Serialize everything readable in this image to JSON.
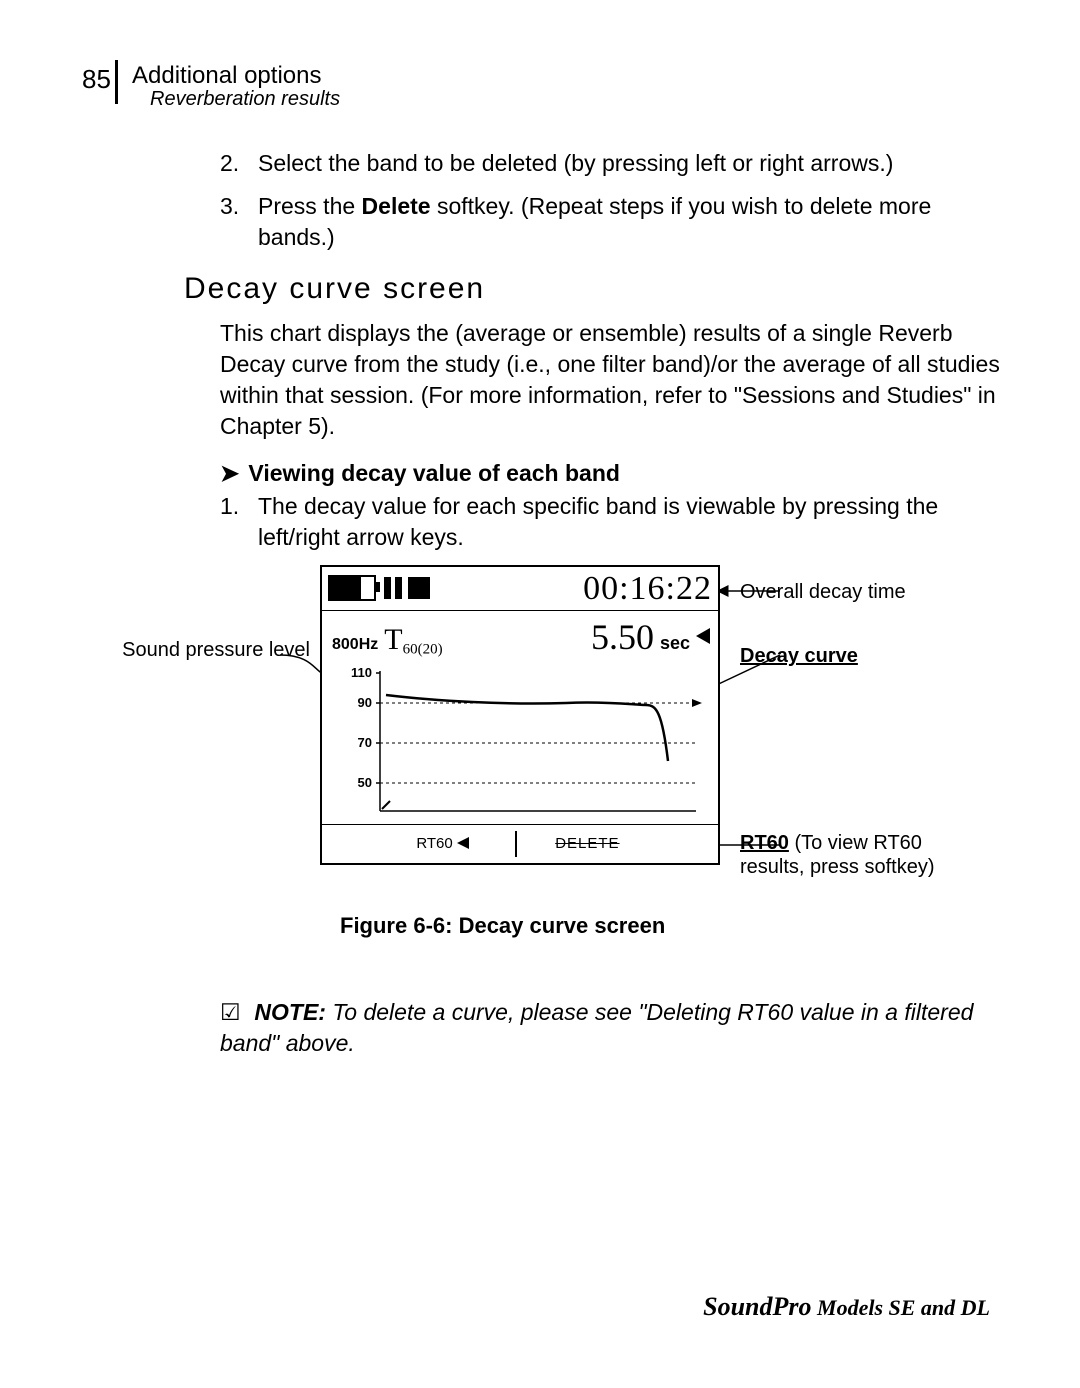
{
  "header": {
    "page_number": "85",
    "title": "Additional options",
    "subtitle": "Reverberation results"
  },
  "steps": {
    "s2_num": "2.",
    "s2_txt": "Select the band to be deleted (by pressing left or right arrows.)",
    "s3_num": "3.",
    "s3_txt_a": "Press the ",
    "s3_bold": "Delete",
    "s3_txt_b": " softkey.  (Repeat steps if you wish to delete more bands.)"
  },
  "section_heading": "Decay curve screen",
  "para1": "This chart displays the (average or ensemble) results of a single Reverb Decay curve from the study (i.e., one filter band)/or the average of all studies within that session.  (For more information, refer to \"Sessions and Studies\" in Chapter 5).",
  "proc": {
    "arrow": "➤",
    "heading": "Viewing decay value of each band",
    "item1_num": "1.",
    "item1_txt": "The decay value for each specific band is viewable by pressing the left/right arrow keys."
  },
  "lcd": {
    "time": "00:16:22",
    "band": "800Hz",
    "t_big": "T",
    "t_sub": "60(20)",
    "value": "5.50",
    "sec": "sec",
    "soft_rt60": "RT60",
    "soft_delete": "DELETE",
    "yticks": {
      "y110": "110",
      "y90": "90",
      "y70": "70",
      "y50": "50"
    }
  },
  "annotations": {
    "spl": "Sound pressure level",
    "overall": "Overall decay time",
    "decay_curve": "Decay curve",
    "rt60_a": "RT60",
    "rt60_b": "  (To view RT60 results, press softkey)"
  },
  "figure_caption": "Figure 6-6:  Decay curve screen",
  "note": {
    "check": "☑",
    "label": "NOTE:",
    "text": "  To delete a curve, please see \"Deleting RT60 value in a filtered band\" above."
  },
  "footer": {
    "brand": "SoundPro",
    "models": "  Models SE and DL"
  },
  "chart_data": {
    "type": "line",
    "title": "Decay curve",
    "xlabel": "",
    "ylabel": "Sound pressure level (dB)",
    "ylim": [
      40,
      115
    ],
    "yticks": [
      50,
      70,
      90,
      110
    ],
    "series": [
      {
        "name": "Decay curve",
        "x": [
          0.0,
          0.1,
          0.2,
          0.3,
          0.4,
          0.5,
          0.6,
          0.7,
          0.78,
          0.85
        ],
        "y": [
          95,
          93,
          92,
          91,
          90,
          90,
          91,
          90,
          90,
          60
        ]
      }
    ],
    "overall_decay_time": "00:16:22",
    "band_hz": 800,
    "decay_metric": "T60(20)",
    "decay_value_sec": 5.5
  }
}
